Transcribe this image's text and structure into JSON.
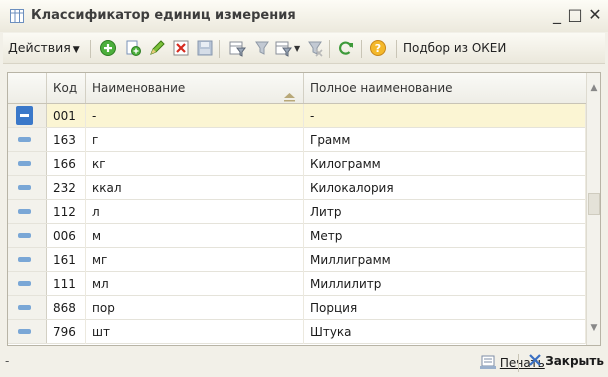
{
  "window": {
    "title": "Классификатор единиц измерения"
  },
  "toolbar": {
    "actions_label": "Действия",
    "okei_label": "Подбор из ОКЕИ",
    "icons": [
      "add-icon",
      "copy-icon",
      "edit-icon",
      "delete-icon",
      "save-icon",
      "filter-icon",
      "filter-off-icon",
      "filter-menu-icon",
      "clear-filter-icon",
      "refresh-icon",
      "help-icon"
    ]
  },
  "grid": {
    "columns": [
      "Код",
      "Наименование",
      "Полное наименование"
    ],
    "rows": [
      {
        "code": "001",
        "name": "-",
        "full": "-",
        "selected": true
      },
      {
        "code": "163",
        "name": "г",
        "full": "Грамм"
      },
      {
        "code": "166",
        "name": "кг",
        "full": "Килограмм"
      },
      {
        "code": "232",
        "name": "ккал",
        "full": "Килокалория"
      },
      {
        "code": "112",
        "name": "л",
        "full": "Литр"
      },
      {
        "code": "006",
        "name": "м",
        "full": "Метр"
      },
      {
        "code": "161",
        "name": "мг",
        "full": "Миллиграмм"
      },
      {
        "code": "111",
        "name": "мл",
        "full": "Миллилитр"
      },
      {
        "code": "868",
        "name": "пор",
        "full": "Порция"
      },
      {
        "code": "796",
        "name": "шт",
        "full": "Штука"
      }
    ]
  },
  "footer": {
    "status": "-",
    "print_label": "Печать",
    "close_label": "Закрыть"
  },
  "colors": {
    "accent": "#3a78c9",
    "selected_row": "#fbf5d3"
  }
}
